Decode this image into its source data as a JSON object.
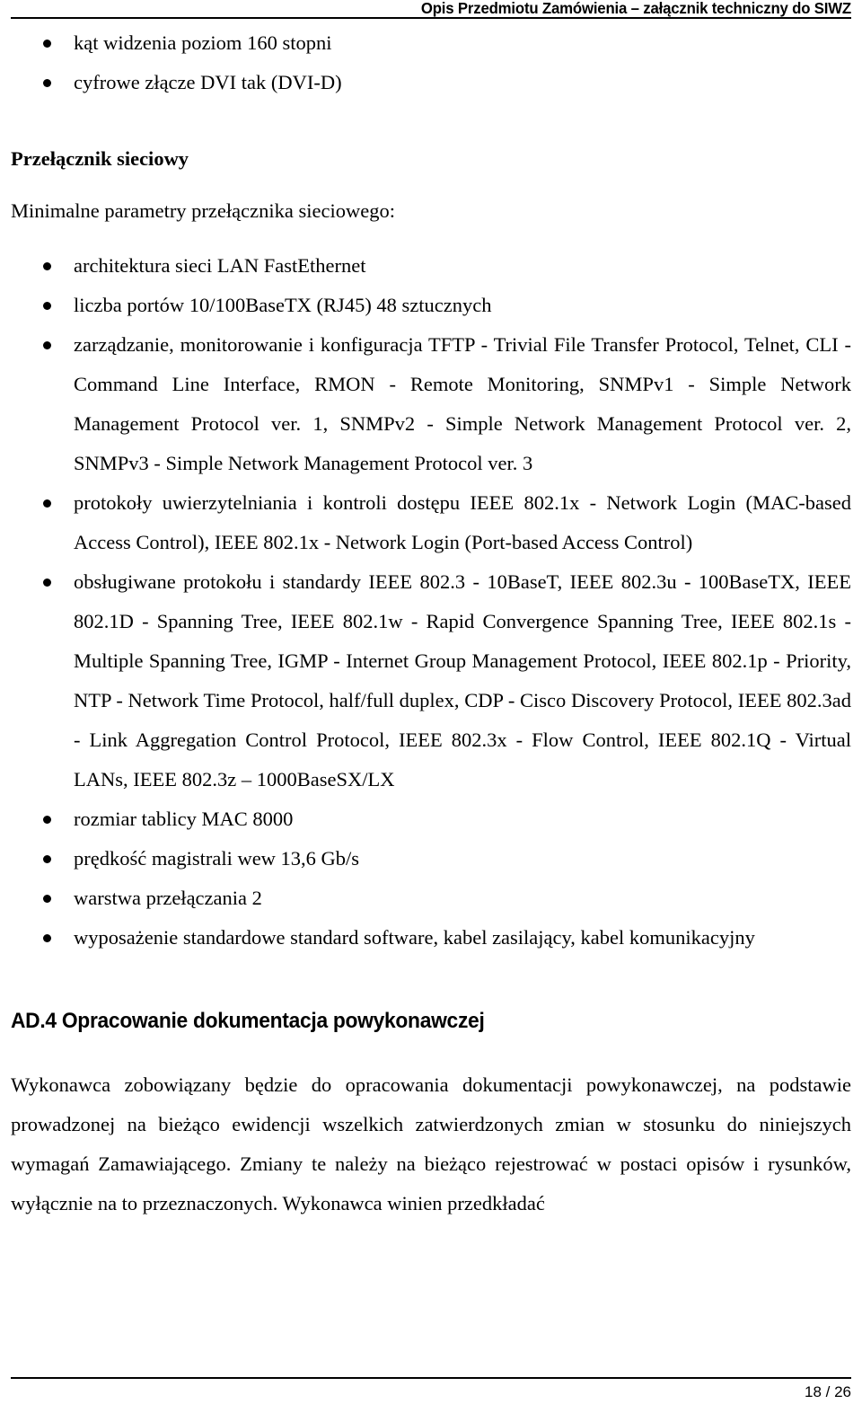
{
  "header": {
    "title": "Opis Przedmiotu Zamówienia – załącznik techniczny do SIWZ"
  },
  "monitor_bullets": [
    "kąt widzenia poziom 160 stopni",
    "cyfrowe złącze DVI tak (DVI-D)"
  ],
  "switch_section": {
    "heading": "Przełącznik sieciowy",
    "lead": "Minimalne parametry przełącznika sieciowego:",
    "bullets": [
      "architektura sieci LAN FastEthernet",
      "liczba portów 10/100BaseTX (RJ45) 48 sztucznych",
      "zarządzanie, monitorowanie i konfiguracja TFTP - Trivial File Transfer Protocol, Telnet, CLI - Command Line Interface, RMON - Remote Monitoring, SNMPv1 - Simple Network Management Protocol ver. 1, SNMPv2 - Simple Network Management Protocol ver. 2, SNMPv3 - Simple Network Management Protocol ver. 3",
      "protokoły uwierzytelniania i kontroli dostępu IEEE 802.1x - Network Login (MAC-based Access Control), IEEE 802.1x - Network Login (Port-based Access Control)",
      "obsługiwane protokołu i standardy IEEE 802.3 - 10BaseT, IEEE 802.3u - 100BaseTX, IEEE 802.1D - Spanning Tree, IEEE 802.1w - Rapid Convergence Spanning Tree, IEEE 802.1s - Multiple Spanning Tree, IGMP - Internet Group Management Protocol, IEEE 802.1p - Priority, NTP - Network Time Protocol, half/full duplex, CDP - Cisco Discovery Protocol, IEEE 802.3ad - Link Aggregation Control Protocol, IEEE 802.3x - Flow Control, IEEE 802.1Q - Virtual LANs, IEEE 802.3z – 1000BaseSX/LX",
      "rozmiar tablicy MAC 8000",
      "prędkość magistrali wew 13,6 Gb/s",
      "warstwa przełączania 2",
      "wyposażenie standardowe standard software, kabel zasilający, kabel komunikacyjny"
    ]
  },
  "ad4_section": {
    "heading": "AD.4 Opracowanie dokumentacja powykonawczej",
    "paragraph": "Wykonawca zobowiązany będzie do opracowania dokumentacji powykonawczej, na podstawie prowadzonej na bieżąco ewidencji wszelkich zatwierdzonych zmian w stosunku do niniejszych wymagań Zamawiającego. Zmiany te należy na bieżąco rejestrować w postaci opisów i rysunków, wyłącznie na to przeznaczonych. Wykonawca winien przedkładać"
  },
  "footer": {
    "page": "18 / 26"
  }
}
